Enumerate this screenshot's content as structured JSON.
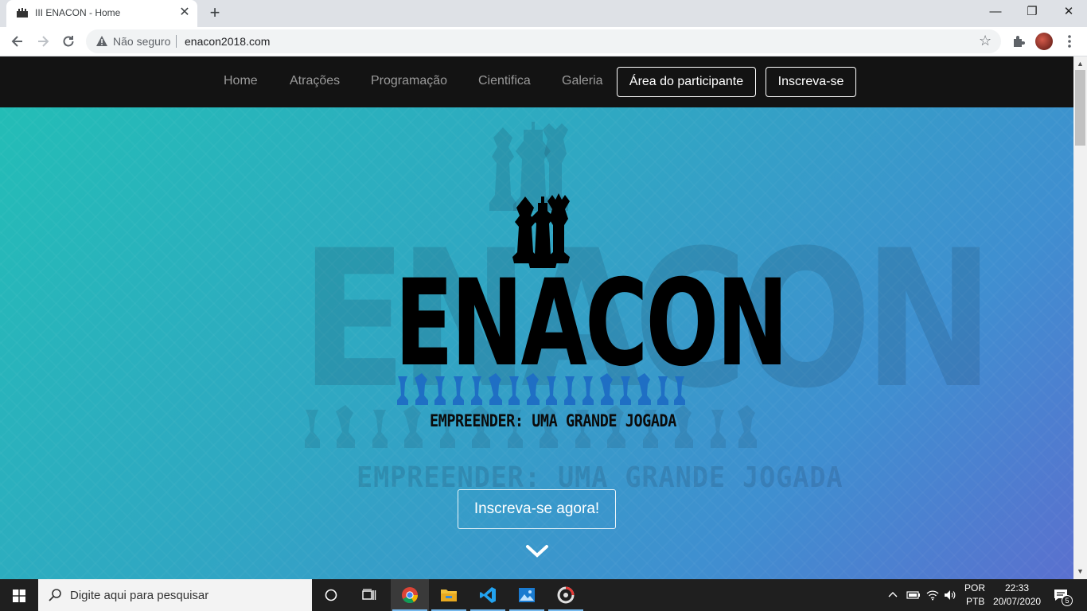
{
  "browser": {
    "tab_title": "III ENACON - Home",
    "tab_close": "✕",
    "new_tab": "+",
    "security_label": "Não seguro",
    "url": "enacon2018.com",
    "window_controls": {
      "minimize": "—",
      "maximize": "❐",
      "close": "✕"
    }
  },
  "nav": {
    "links": [
      "Home",
      "Atrações",
      "Programação",
      "Cientifica",
      "Galeria"
    ],
    "participant_button": "Área do participante",
    "signup_button": "Inscreva-se"
  },
  "hero": {
    "logo_text": "ENACON",
    "tagline": "EMPREENDER: UMA GRANDE JOGADA",
    "cta_button": "Inscreva-se agora!",
    "colors": {
      "gradient_start": "#23bdb6",
      "gradient_end": "#5a70cf",
      "pawn_row": "#1f6fc4"
    }
  },
  "taskbar": {
    "search_placeholder": "Digite aqui para pesquisar",
    "language_top": "POR",
    "language_bottom": "PTB",
    "time": "22:33",
    "date": "20/07/2020",
    "notification_count": "5"
  }
}
